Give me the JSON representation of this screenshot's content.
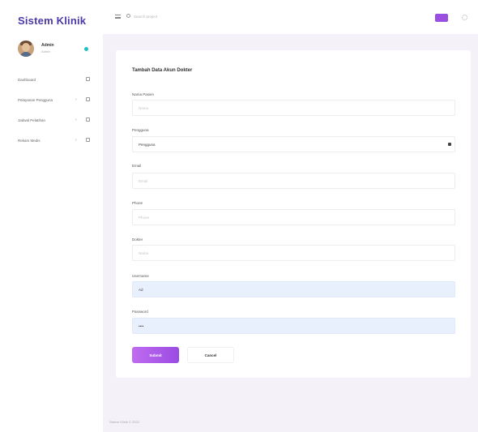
{
  "app": {
    "title": "Sistem Klinik"
  },
  "user": {
    "name": "Admin",
    "role": "Admin",
    "status_color": "#20c0c0"
  },
  "sidebar": {
    "items": [
      {
        "label": "Dashboard"
      },
      {
        "label": "Pelayanan Pengguna"
      },
      {
        "label": "Jadwal Pelatihan"
      },
      {
        "label": "Rekam Medis"
      }
    ]
  },
  "topbar": {
    "search_placeholder": "Search project"
  },
  "form": {
    "title": "Tambah Data Akun Dokter",
    "fields": [
      {
        "label": "Nama Pasien",
        "placeholder": "Nama",
        "value": ""
      },
      {
        "label": "Pengguna",
        "value": "Pengguna"
      },
      {
        "label": "Email",
        "placeholder": "Email",
        "value": ""
      },
      {
        "label": "Phone",
        "placeholder": "Phone",
        "value": ""
      },
      {
        "label": "Dokter",
        "placeholder": "Nama",
        "value": ""
      },
      {
        "label": "Username",
        "placeholder": "",
        "value": "Ad"
      },
      {
        "label": "Password",
        "placeholder": "",
        "value": "••••"
      }
    ],
    "submit_label": "Submit",
    "cancel_label": "Cancel"
  },
  "colors": {
    "brand": "#4a3aa8",
    "accent": "#9b4fe0",
    "content_bg": "#f4f1f9",
    "autofill_bg": "#e8f0fe"
  },
  "icons": {
    "menu": "hamburger-icon",
    "search": "search-icon",
    "settings": "gear-icon",
    "select": "chevron-down-icon"
  },
  "footer": {
    "text": "Sistem Klinik © 2022"
  }
}
